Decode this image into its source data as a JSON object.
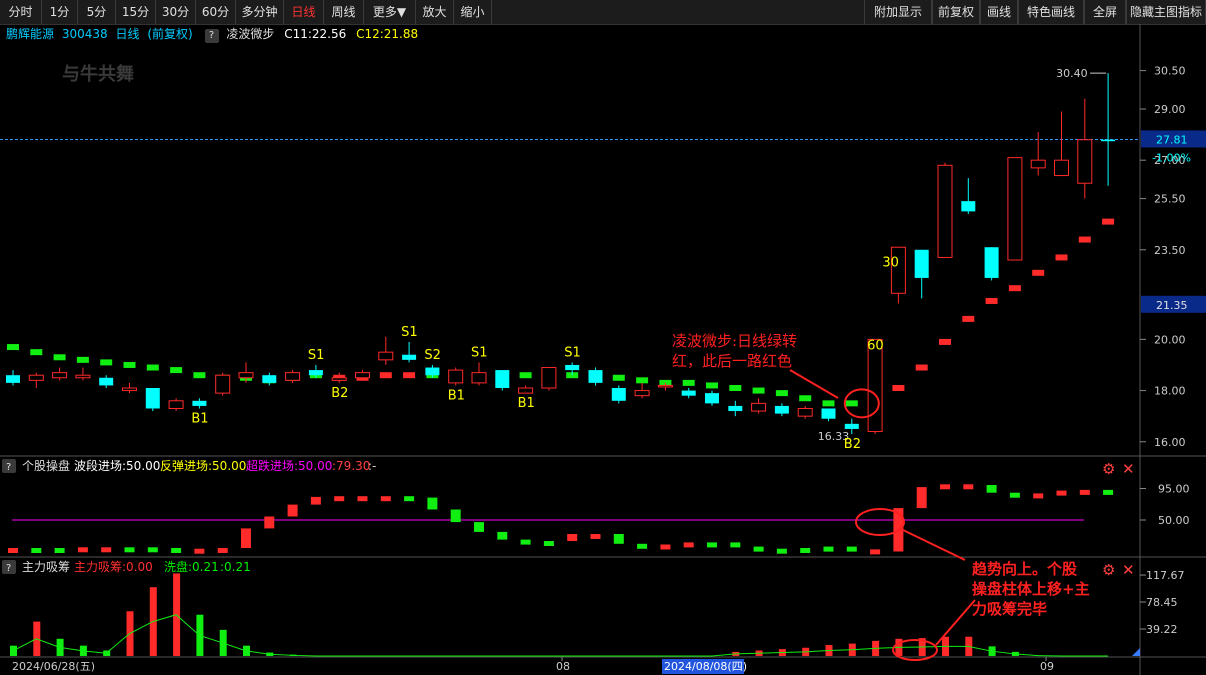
{
  "toolbar": {
    "left": [
      "分时",
      "1分",
      "5分",
      "15分",
      "30分",
      "60分",
      "多分钟",
      "日线",
      "周线",
      "更多▼",
      "放大",
      "缩小"
    ],
    "active": "日线",
    "right": [
      "附加显示",
      "前复权",
      "画线",
      "特色画线",
      "全屏",
      "隐藏主图指标"
    ]
  },
  "info": {
    "stock": "鹏辉能源",
    "code": "300438",
    "period": "日线",
    "adjust": "(前复权)",
    "indicator": "凌波微步",
    "c1": "C11:22.56",
    "c2": "C12:21.88"
  },
  "price_panel": {
    "y_ticks": [
      "30.50",
      "29.00",
      "27.00",
      "25.50",
      "23.50",
      "20.00",
      "18.00",
      "16.00"
    ],
    "current_price": "27.81",
    "current_change": "-1.00%",
    "level_label": "21.35",
    "high_label": "30.40",
    "low_label": "16.33",
    "colors": {
      "up": "#ff3030",
      "down": "#00ffff",
      "signal_green": "#00ee00",
      "signal_red": "#ff0000",
      "label_yellow": "#ffff00"
    }
  },
  "chart_data": {
    "type": "candlestick",
    "ylim": [
      15.6,
      31.5
    ],
    "candles": [
      {
        "o": 18.6,
        "c": 18.3,
        "h": 18.8,
        "l": 18.2
      },
      {
        "o": 18.4,
        "c": 18.6,
        "h": 18.7,
        "l": 18.1
      },
      {
        "o": 18.5,
        "c": 18.7,
        "h": 18.9,
        "l": 18.4
      },
      {
        "o": 18.5,
        "c": 18.6,
        "h": 18.9,
        "l": 18.4
      },
      {
        "o": 18.5,
        "c": 18.2,
        "h": 18.6,
        "l": 18.1
      },
      {
        "o": 18.0,
        "c": 18.1,
        "h": 18.3,
        "l": 17.9
      },
      {
        "o": 18.1,
        "c": 17.3,
        "h": 18.1,
        "l": 17.2
      },
      {
        "o": 17.3,
        "c": 17.6,
        "h": 17.7,
        "l": 17.2
      },
      {
        "o": 17.6,
        "c": 17.4,
        "h": 17.7,
        "l": 17.3
      },
      {
        "o": 17.9,
        "c": 18.6,
        "h": 18.7,
        "l": 17.8
      },
      {
        "o": 18.5,
        "c": 18.7,
        "h": 19.1,
        "l": 18.3
      },
      {
        "o": 18.6,
        "c": 18.3,
        "h": 18.7,
        "l": 18.2
      },
      {
        "o": 18.4,
        "c": 18.7,
        "h": 18.8,
        "l": 18.3
      },
      {
        "o": 18.8,
        "c": 18.6,
        "h": 19.0,
        "l": 18.5
      },
      {
        "o": 18.4,
        "c": 18.5,
        "h": 18.7,
        "l": 18.3
      },
      {
        "o": 18.5,
        "c": 18.7,
        "h": 18.8,
        "l": 18.4
      },
      {
        "o": 19.2,
        "c": 19.5,
        "h": 20.1,
        "l": 19.0
      },
      {
        "o": 19.4,
        "c": 19.2,
        "h": 19.9,
        "l": 19.1
      },
      {
        "o": 18.9,
        "c": 18.6,
        "h": 19.0,
        "l": 18.5
      },
      {
        "o": 18.3,
        "c": 18.8,
        "h": 18.9,
        "l": 18.2
      },
      {
        "o": 18.3,
        "c": 18.7,
        "h": 19.1,
        "l": 18.2
      },
      {
        "o": 18.8,
        "c": 18.1,
        "h": 18.8,
        "l": 18.0
      },
      {
        "o": 17.9,
        "c": 18.1,
        "h": 18.2,
        "l": 17.9
      },
      {
        "o": 18.1,
        "c": 18.9,
        "h": 18.9,
        "l": 18.0
      },
      {
        "o": 19.0,
        "c": 18.8,
        "h": 19.1,
        "l": 18.6
      },
      {
        "o": 18.8,
        "c": 18.3,
        "h": 18.9,
        "l": 18.2
      },
      {
        "o": 18.1,
        "c": 17.6,
        "h": 18.2,
        "l": 17.5
      },
      {
        "o": 17.8,
        "c": 18.0,
        "h": 18.3,
        "l": 17.7
      },
      {
        "o": 18.2,
        "c": 18.2,
        "h": 18.3,
        "l": 18.0
      },
      {
        "o": 18.0,
        "c": 17.8,
        "h": 18.1,
        "l": 17.7
      },
      {
        "o": 17.9,
        "c": 17.5,
        "h": 18.0,
        "l": 17.4
      },
      {
        "o": 17.4,
        "c": 17.2,
        "h": 17.6,
        "l": 17.0
      },
      {
        "o": 17.2,
        "c": 17.5,
        "h": 17.7,
        "l": 17.1
      },
      {
        "o": 17.4,
        "c": 17.1,
        "h": 17.5,
        "l": 17.0
      },
      {
        "o": 17.0,
        "c": 17.3,
        "h": 17.4,
        "l": 16.9
      },
      {
        "o": 17.3,
        "c": 16.9,
        "h": 17.3,
        "l": 16.8
      },
      {
        "o": 16.7,
        "c": 16.5,
        "h": 16.9,
        "l": 16.3
      },
      {
        "o": 16.4,
        "c": 20.0,
        "h": 20.0,
        "l": 16.3
      },
      {
        "o": 21.8,
        "c": 23.6,
        "h": 23.6,
        "l": 21.4
      },
      {
        "o": 23.5,
        "c": 22.4,
        "h": 23.5,
        "l": 21.6
      },
      {
        "o": 23.2,
        "c": 26.8,
        "h": 26.9,
        "l": 23.2
      },
      {
        "o": 25.4,
        "c": 25.0,
        "h": 26.3,
        "l": 24.9
      },
      {
        "o": 23.6,
        "c": 22.4,
        "h": 23.6,
        "l": 22.3
      },
      {
        "o": 23.1,
        "c": 27.1,
        "h": 27.1,
        "l": 23.1
      },
      {
        "o": 26.7,
        "c": 27.0,
        "h": 28.1,
        "l": 26.4
      },
      {
        "o": 26.4,
        "c": 27.0,
        "h": 28.9,
        "l": 26.4
      },
      {
        "o": 26.1,
        "c": 27.8,
        "h": 29.4,
        "l": 25.5
      },
      {
        "o": 27.8,
        "c": 27.75,
        "h": 30.4,
        "l": 26.0
      }
    ],
    "signal": [
      {
        "v": 19.7,
        "c": "g"
      },
      {
        "v": 19.5,
        "c": "g"
      },
      {
        "v": 19.3,
        "c": "g"
      },
      {
        "v": 19.2,
        "c": "g"
      },
      {
        "v": 19.1,
        "c": "g"
      },
      {
        "v": 19.0,
        "c": "g"
      },
      {
        "v": 18.9,
        "c": "g"
      },
      {
        "v": 18.8,
        "c": "g"
      },
      {
        "v": 18.6,
        "c": "g"
      },
      {
        "v": 18.5,
        "c": "g"
      },
      {
        "v": 18.5,
        "c": "g"
      },
      {
        "v": 18.4,
        "c": "g"
      },
      {
        "v": 18.5,
        "c": "g"
      },
      {
        "v": 18.6,
        "c": "g"
      },
      {
        "v": 18.5,
        "c": "r"
      },
      {
        "v": 18.5,
        "c": "r"
      },
      {
        "v": 18.6,
        "c": "r"
      },
      {
        "v": 18.6,
        "c": "r"
      },
      {
        "v": 18.6,
        "c": "g"
      },
      {
        "v": 18.6,
        "c": "g"
      },
      {
        "v": 18.5,
        "c": "g"
      },
      {
        "v": 18.6,
        "c": "g"
      },
      {
        "v": 18.6,
        "c": "g"
      },
      {
        "v": 18.6,
        "c": "g"
      },
      {
        "v": 18.6,
        "c": "g"
      },
      {
        "v": 18.6,
        "c": "g"
      },
      {
        "v": 18.5,
        "c": "g"
      },
      {
        "v": 18.4,
        "c": "g"
      },
      {
        "v": 18.3,
        "c": "g"
      },
      {
        "v": 18.3,
        "c": "g"
      },
      {
        "v": 18.2,
        "c": "g"
      },
      {
        "v": 18.1,
        "c": "g"
      },
      {
        "v": 18.0,
        "c": "g"
      },
      {
        "v": 17.9,
        "c": "g"
      },
      {
        "v": 17.7,
        "c": "g"
      },
      {
        "v": 17.5,
        "c": "g"
      },
      {
        "v": 17.5,
        "c": "g"
      },
      {
        "v": 17.6,
        "c": "r"
      },
      {
        "v": 18.1,
        "c": "r"
      },
      {
        "v": 18.9,
        "c": "r"
      },
      {
        "v": 19.9,
        "c": "r"
      },
      {
        "v": 20.8,
        "c": "r"
      },
      {
        "v": 21.5,
        "c": "r"
      },
      {
        "v": 22.0,
        "c": "r"
      },
      {
        "v": 22.6,
        "c": "r"
      },
      {
        "v": 23.2,
        "c": "r"
      },
      {
        "v": 23.9,
        "c": "r"
      },
      {
        "v": 24.6,
        "c": "r"
      }
    ],
    "labels": [
      {
        "i": 8,
        "text": "B1"
      },
      {
        "i": 13,
        "text": "S1"
      },
      {
        "i": 14,
        "text": "B2"
      },
      {
        "i": 17,
        "text": "S1"
      },
      {
        "i": 18,
        "text": "S2"
      },
      {
        "i": 19,
        "text": "B1"
      },
      {
        "i": 20,
        "text": "S1"
      },
      {
        "i": 22,
        "text": "B1"
      },
      {
        "i": 24,
        "text": "S1"
      },
      {
        "i": 36,
        "text": "B2"
      },
      {
        "i": 37,
        "text": "60"
      },
      {
        "i": 38,
        "text": "30"
      }
    ]
  },
  "panel2": {
    "title": "个股操盘",
    "legend": [
      "波段进场:50.00",
      "反弹进场:50.00",
      "超跌进场:50.00",
      ":79.30",
      ":-"
    ],
    "legend_colors": [
      "#ffffff",
      "#ffff00",
      "#ff00ff",
      "#ff4040",
      "#cccccc"
    ],
    "y_ticks": [
      "95.00",
      "50.00"
    ],
    "ylim": [
      0,
      110
    ],
    "bars": [
      {
        "v": 10,
        "c": "r"
      },
      {
        "v": 10,
        "c": "g"
      },
      {
        "v": 10,
        "c": "g"
      },
      {
        "v": 11,
        "c": "r"
      },
      {
        "v": 10,
        "c": "r"
      },
      {
        "v": 11,
        "c": "g"
      },
      {
        "v": 10,
        "c": "g"
      },
      {
        "v": 8,
        "c": "g"
      },
      {
        "v": 9,
        "c": "r"
      },
      {
        "v": 10,
        "c": "r"
      },
      {
        "v": 38,
        "c": "r"
      },
      {
        "v": 55,
        "c": "r"
      },
      {
        "v": 72,
        "c": "r"
      },
      {
        "v": 83,
        "c": "r"
      },
      {
        "v": 84,
        "c": "r"
      },
      {
        "v": 84,
        "c": "r"
      },
      {
        "v": 84,
        "c": "r"
      },
      {
        "v": 82,
        "c": "g"
      },
      {
        "v": 65,
        "c": "g"
      },
      {
        "v": 47,
        "c": "g"
      },
      {
        "v": 33,
        "c": "g"
      },
      {
        "v": 22,
        "c": "g"
      },
      {
        "v": 16,
        "c": "g"
      },
      {
        "v": 20,
        "c": "g"
      },
      {
        "v": 30,
        "c": "r"
      },
      {
        "v": 30,
        "c": "r"
      },
      {
        "v": 16,
        "c": "g"
      },
      {
        "v": 12,
        "c": "g"
      },
      {
        "v": 15,
        "c": "r"
      },
      {
        "v": 18,
        "c": "r"
      },
      {
        "v": 18,
        "c": "g"
      },
      {
        "v": 12,
        "c": "g"
      },
      {
        "v": 9,
        "c": "g"
      },
      {
        "v": 8,
        "c": "g"
      },
      {
        "v": 10,
        "c": "g"
      },
      {
        "v": 12,
        "c": "g"
      },
      {
        "v": 8,
        "c": "g"
      },
      {
        "v": 5,
        "c": "r"
      },
      {
        "v": 67,
        "c": "r"
      },
      {
        "v": 97,
        "c": "r"
      },
      {
        "v": 101,
        "c": "r"
      },
      {
        "v": 100,
        "c": "r"
      },
      {
        "v": 89,
        "c": "g"
      },
      {
        "v": 87,
        "c": "g"
      },
      {
        "v": 88,
        "c": "r"
      },
      {
        "v": 92,
        "c": "r"
      },
      {
        "v": 93,
        "c": "r"
      },
      {
        "v": 90,
        "c": "g"
      }
    ],
    "line_value": 50
  },
  "panel3": {
    "title": "主力吸筹",
    "legend": [
      "主力吸筹:0.00",
      "洗盘:0.21",
      ":0.21"
    ],
    "legend_colors": [
      "#ff3030",
      "#00ee00",
      "#00ee00"
    ],
    "y_ticks": [
      "117.67",
      "78.45",
      "39.22"
    ],
    "ylim": [
      0,
      125
    ],
    "bars": [
      {
        "v": 15,
        "c": "g"
      },
      {
        "v": 50,
        "c": "r"
      },
      {
        "v": 25,
        "c": "g"
      },
      {
        "v": 15,
        "c": "g"
      },
      {
        "v": 8,
        "c": "g"
      },
      {
        "v": 65,
        "c": "r"
      },
      {
        "v": 100,
        "c": "r"
      },
      {
        "v": 120,
        "c": "r"
      },
      {
        "v": 60,
        "c": "g"
      },
      {
        "v": 38,
        "c": "g"
      },
      {
        "v": 15,
        "c": "g"
      },
      {
        "v": 5,
        "c": "g"
      },
      {
        "v": 2,
        "c": "g"
      },
      {
        "v": 0,
        "c": "g"
      },
      {
        "v": 0,
        "c": "g"
      },
      {
        "v": 0,
        "c": "g"
      },
      {
        "v": 0,
        "c": "g"
      },
      {
        "v": 0,
        "c": "g"
      },
      {
        "v": 0,
        "c": "g"
      },
      {
        "v": 0,
        "c": "g"
      },
      {
        "v": 0,
        "c": "g"
      },
      {
        "v": 0,
        "c": "g"
      },
      {
        "v": 0,
        "c": "g"
      },
      {
        "v": 0,
        "c": "g"
      },
      {
        "v": 0,
        "c": "g"
      },
      {
        "v": 0,
        "c": "g"
      },
      {
        "v": 0,
        "c": "g"
      },
      {
        "v": 0,
        "c": "g"
      },
      {
        "v": 0,
        "c": "g"
      },
      {
        "v": 0,
        "c": "g"
      },
      {
        "v": 0,
        "c": "g"
      },
      {
        "v": 6,
        "c": "r"
      },
      {
        "v": 8,
        "c": "r"
      },
      {
        "v": 10,
        "c": "r"
      },
      {
        "v": 12,
        "c": "r"
      },
      {
        "v": 16,
        "c": "r"
      },
      {
        "v": 18,
        "c": "r"
      },
      {
        "v": 22,
        "c": "r"
      },
      {
        "v": 25,
        "c": "r"
      },
      {
        "v": 26,
        "c": "r"
      },
      {
        "v": 28,
        "c": "r"
      },
      {
        "v": 28,
        "c": "r"
      },
      {
        "v": 14,
        "c": "g"
      },
      {
        "v": 6,
        "c": "g"
      },
      {
        "v": 1,
        "c": "g"
      },
      {
        "v": 0,
        "c": "g"
      },
      {
        "v": 0,
        "c": "g"
      },
      {
        "v": 0,
        "c": "g"
      }
    ]
  },
  "x_axis": {
    "labels": [
      "2024/06/28(五)",
      "08",
      "2024/08/08(四)",
      "09"
    ]
  },
  "annotations": {
    "a1": [
      "凌波微步:日线绿转",
      "红，此后一路红色"
    ],
    "a2": [
      "趋势向上。个股",
      "操盘柱体上移+主",
      "力吸筹完毕"
    ]
  }
}
